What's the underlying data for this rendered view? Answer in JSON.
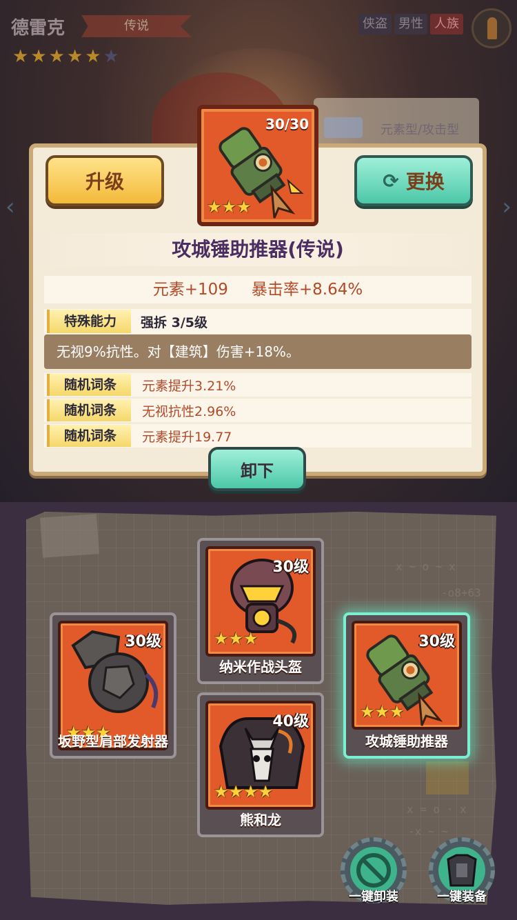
{
  "hero": {
    "name": "德雷克",
    "rarity": "传说",
    "stars_filled": 5,
    "stars_total": 6,
    "tags": [
      "侠盗",
      "男性",
      "人族"
    ]
  },
  "background": {
    "board_text": "元素型/攻击型"
  },
  "panel": {
    "upgrade_label": "升级",
    "swap_label": "更换",
    "item": {
      "level": "30/30",
      "stars": 3,
      "title": "攻城锤助推器(传说)"
    },
    "stats": [
      "元素+109",
      "暴击率+8.64%"
    ],
    "special": {
      "badge": "特殊能力",
      "name": "强拆  3/5级",
      "desc": "无视9%抗性。对【建筑】伤害+18%。"
    },
    "affixes": [
      {
        "badge": "随机词条",
        "text": "元素提升3.21%"
      },
      {
        "badge": "随机词条",
        "text": "无视抗性2.96%"
      },
      {
        "badge": "随机词条",
        "text": "元素提升19.77"
      }
    ],
    "unequip_label": "卸下"
  },
  "equipment": {
    "scribbles": [
      "x ~ o ~ x",
      "-o8+63",
      "x = o · x",
      "-x ~ ~"
    ],
    "slots": [
      {
        "name": "坂野型肩部发射器",
        "level": "30级",
        "stars": 3
      },
      {
        "name": "纳米作战头盔",
        "level": "30级",
        "stars": 3
      },
      {
        "name": "熊和龙",
        "level": "40级",
        "stars": 4
      },
      {
        "name": "攻城锤助推器",
        "level": "30级",
        "stars": 3,
        "selected": true
      }
    ]
  },
  "actions": {
    "unequip_all": "一键卸装",
    "equip_all": "一键装备"
  },
  "colors": {
    "card_orange": "#e25a2a",
    "gold_button": "#f3b93a",
    "teal_button": "#4cc7a8",
    "highlight": "#7af0d0",
    "title_purple": "#4a2e62",
    "stat_red": "#b14a2a"
  }
}
